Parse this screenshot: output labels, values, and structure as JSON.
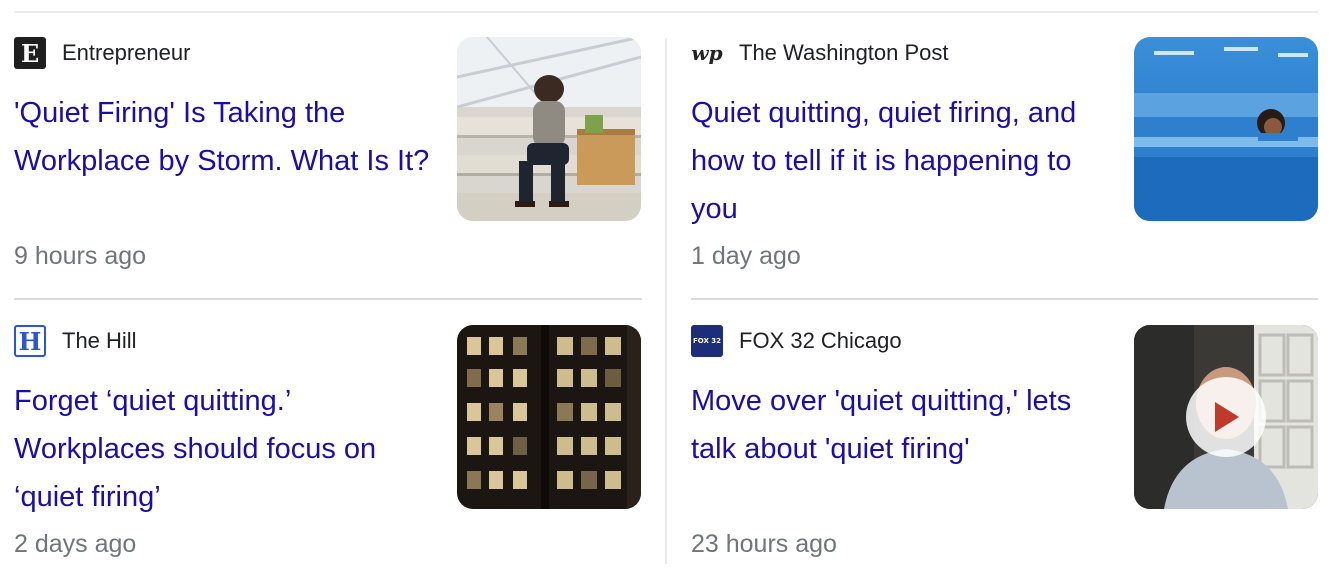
{
  "articles": [
    {
      "source": "Entrepreneur",
      "logo_text": "E",
      "headline": "'Quiet Firing' Is Taking the Workplace by Storm. What Is It?",
      "time": "9 hours ago",
      "thumbnail": "woman-sitting-on-steps-with-box-image",
      "has_video": false
    },
    {
      "source": "The Washington Post",
      "logo_text": "wp",
      "headline": "Quiet quitting, quiet firing, and how to tell if it is happening to you",
      "time": "1 day ago",
      "thumbnail": "woman-peeking-over-cubicle-image",
      "has_video": false
    },
    {
      "source": "The Hill",
      "logo_text": "H",
      "headline": "Forget ‘quiet quitting.’ Workplaces should focus on ‘quiet firing’",
      "time": "2 days ago",
      "thumbnail": "office-building-night-windows-image",
      "has_video": false
    },
    {
      "source": "FOX 32 Chicago",
      "logo_text": "FOX 32",
      "headline": "Move over 'quiet quitting,' lets talk about 'quiet firing'",
      "time": "23 hours ago",
      "thumbnail": "man-video-call-image",
      "has_video": true
    }
  ],
  "colors": {
    "headline": "#1a0dab",
    "source": "#202124",
    "timestamp": "#70757a",
    "divider": "#dadce0"
  }
}
